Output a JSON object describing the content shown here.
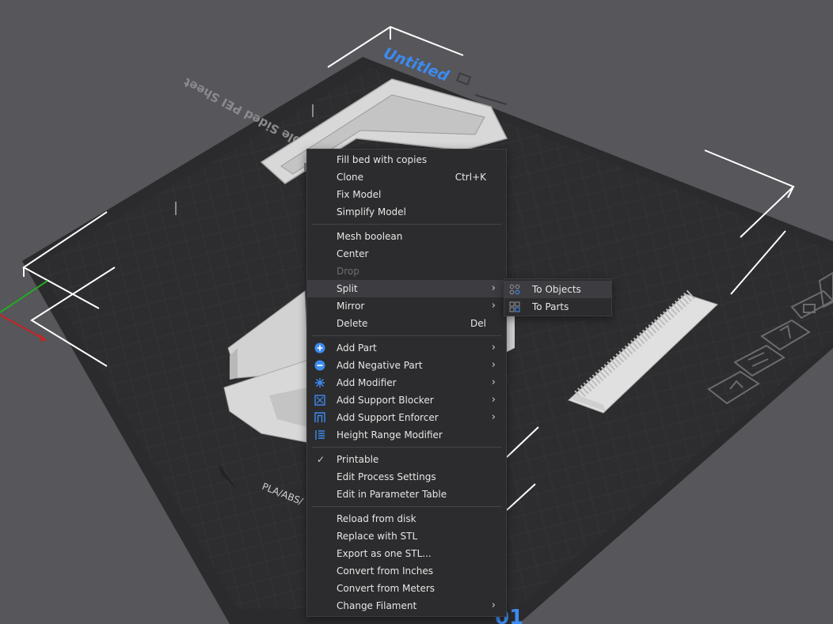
{
  "scene": {
    "plate_title": "Untitled",
    "plate_label": "Double Sided PEI Sheet",
    "filament_label": "PLA/ABS/"
  },
  "context_menu": {
    "items": [
      {
        "label": "Fill bed with copies"
      },
      {
        "label": "Clone",
        "shortcut": "Ctrl+K"
      },
      {
        "label": "Fix Model"
      },
      {
        "label": "Simplify Model"
      },
      {
        "label": "Mesh boolean"
      },
      {
        "label": "Center"
      },
      {
        "label": "Drop",
        "disabled": true
      },
      {
        "label": "Split",
        "submenu": true,
        "highlighted": true
      },
      {
        "label": "Mirror",
        "submenu": true
      },
      {
        "label": "Delete",
        "shortcut": "Del"
      },
      {
        "label": "Add Part",
        "icon": "add-part-icon",
        "submenu": true
      },
      {
        "label": "Add Negative Part",
        "icon": "negative-part-icon",
        "submenu": true
      },
      {
        "label": "Add Modifier",
        "icon": "modifier-icon",
        "submenu": true
      },
      {
        "label": "Add Support Blocker",
        "icon": "support-blocker-icon",
        "submenu": true
      },
      {
        "label": "Add Support Enforcer",
        "icon": "support-enforcer-icon",
        "submenu": true
      },
      {
        "label": "Height Range Modifier",
        "icon": "height-range-icon"
      },
      {
        "label": "Printable",
        "checked": true
      },
      {
        "label": "Edit Process Settings"
      },
      {
        "label": "Edit in Parameter Table"
      },
      {
        "label": "Reload from disk"
      },
      {
        "label": "Replace with STL"
      },
      {
        "label": "Export as one STL..."
      },
      {
        "label": "Convert from Inches"
      },
      {
        "label": "Convert from Meters"
      },
      {
        "label": "Change Filament",
        "submenu": true
      }
    ]
  },
  "split_submenu": {
    "items": [
      {
        "label": "To Objects",
        "icon": "split-objects-icon"
      },
      {
        "label": "To Parts",
        "icon": "split-parts-icon"
      }
    ]
  },
  "colors": {
    "background": "#56565b",
    "plate": "#2f2f31",
    "menu_bg": "#2c2c2e",
    "accent_blue": "#3d8bef",
    "highlight": "#3d3d41"
  }
}
